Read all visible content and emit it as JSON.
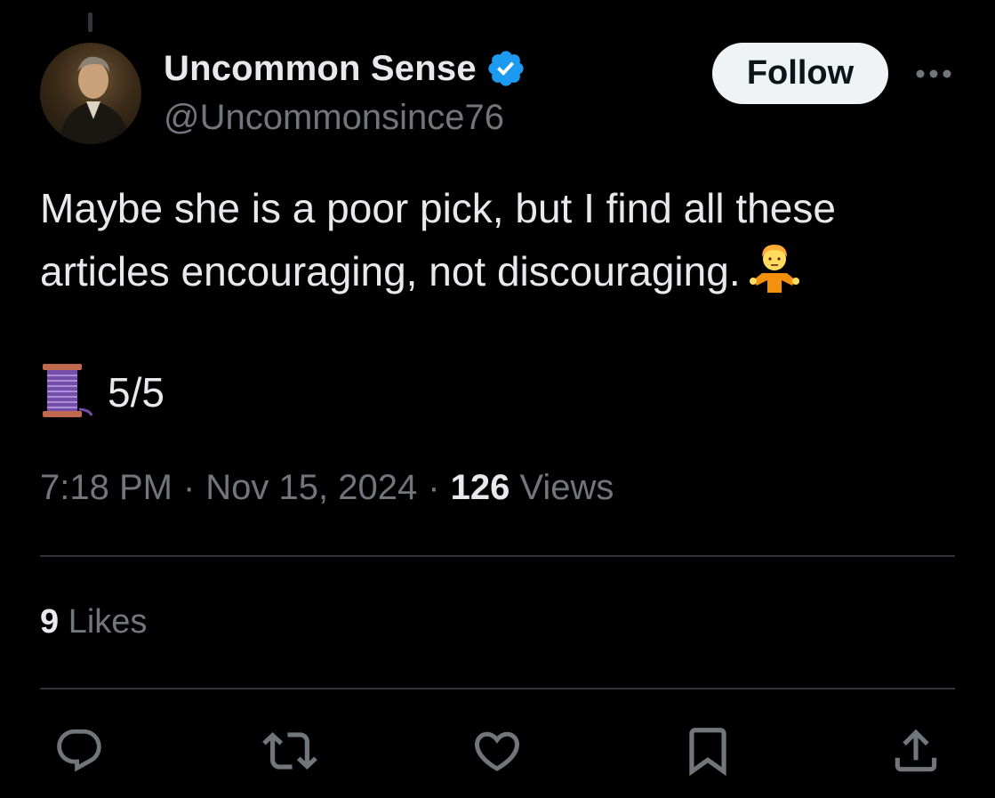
{
  "author": {
    "display_name": "Uncommon Sense",
    "handle": "@Uncommonsince76",
    "verified": true,
    "verified_color": "#1d9bf0"
  },
  "follow_button": {
    "label": "Follow"
  },
  "more_button": {
    "icon": "more-horizontal-icon"
  },
  "tweet": {
    "text_line_1": "Maybe she is a poor pick, but I find all these",
    "text_line_2": "articles encouraging, not discouraging.",
    "trailing_emoji": "person-shrugging-emoji",
    "thread_emoji": "thread-spool-emoji",
    "thread_count": "5/5"
  },
  "meta": {
    "time": "7:18 PM",
    "date": "Nov 15, 2024",
    "separator": "·",
    "views_count": "126",
    "views_label": "Views"
  },
  "stats": {
    "likes_count": "9",
    "likes_label": "Likes"
  },
  "actions": [
    {
      "name": "reply",
      "icon": "reply-icon"
    },
    {
      "name": "retweet",
      "icon": "retweet-icon"
    },
    {
      "name": "like",
      "icon": "heart-icon"
    },
    {
      "name": "bookmark",
      "icon": "bookmark-icon"
    },
    {
      "name": "share",
      "icon": "share-icon"
    }
  ],
  "colors": {
    "background": "#000000",
    "primary_text": "#e7e9ea",
    "secondary_text": "#71767b",
    "divider": "#2f3336",
    "follow_button_bg": "#eff3f4"
  }
}
